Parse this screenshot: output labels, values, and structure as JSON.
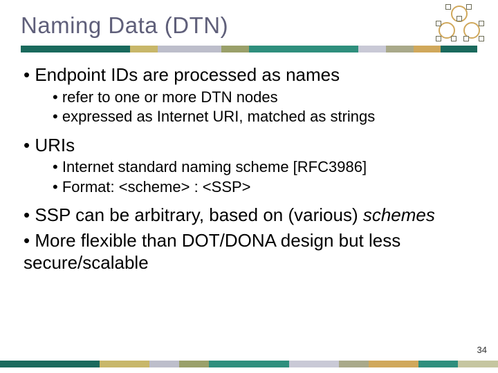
{
  "slide": {
    "title": "Naming Data (DTN)",
    "page_number": "34"
  },
  "bullets": {
    "b1": "Endpoint IDs are processed as names",
    "b1a": "refer to one or more DTN nodes",
    "b1b": "expressed as Internet URI, matched as strings",
    "b2": "URIs",
    "b2a": "Internet standard naming scheme [RFC3986]",
    "b2b": "Format: <scheme> : <SSP>",
    "b3_pre": "SSP can be arbitrary, based on (various) ",
    "b3_em": "schemes",
    "b4": "More flexible than DOT/DONA design but less secure/scalable"
  }
}
